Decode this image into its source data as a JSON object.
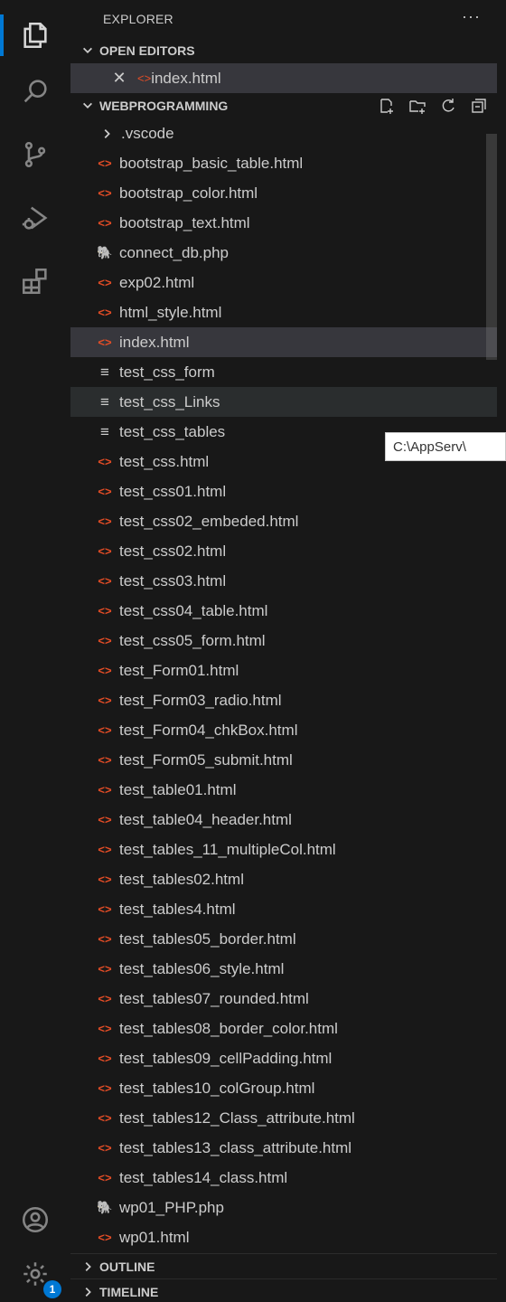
{
  "activity": [
    {
      "name": "explorer-icon",
      "active": true
    },
    {
      "name": "search-icon",
      "active": false
    },
    {
      "name": "source-control-icon",
      "active": false
    },
    {
      "name": "run-debug-icon",
      "active": false
    },
    {
      "name": "extensions-icon",
      "active": false
    }
  ],
  "activity_bottom": {
    "account": "account-icon",
    "settings": "gear-icon",
    "settings_badge": "1"
  },
  "explorer": {
    "title": "EXPLORER",
    "more": "···"
  },
  "open_editors": {
    "label": "OPEN EDITORS",
    "items": [
      {
        "name": "index.html",
        "icon": "html"
      }
    ]
  },
  "workspace": {
    "label": "WEBPROGRAMMING",
    "actions": [
      "new-file-icon",
      "new-folder-icon",
      "refresh-icon",
      "collapse-all-icon"
    ],
    "items": [
      {
        "name": ".vscode",
        "icon": "folder"
      },
      {
        "name": "bootstrap_basic_table.html",
        "icon": "html"
      },
      {
        "name": "bootstrap_color.html",
        "icon": "html"
      },
      {
        "name": "bootstrap_text.html",
        "icon": "html"
      },
      {
        "name": "connect_db.php",
        "icon": "php"
      },
      {
        "name": "exp02.html",
        "icon": "html"
      },
      {
        "name": "html_style.html",
        "icon": "html"
      },
      {
        "name": "index.html",
        "icon": "html",
        "state": "selected"
      },
      {
        "name": "test_css_form",
        "icon": "txt"
      },
      {
        "name": "test_css_Links",
        "icon": "txt",
        "state": "hover"
      },
      {
        "name": "test_css_tables",
        "icon": "txt"
      },
      {
        "name": "test_css.html",
        "icon": "html"
      },
      {
        "name": "test_css01.html",
        "icon": "html"
      },
      {
        "name": "test_css02_embeded.html",
        "icon": "html"
      },
      {
        "name": "test_css02.html",
        "icon": "html"
      },
      {
        "name": "test_css03.html",
        "icon": "html"
      },
      {
        "name": "test_css04_table.html",
        "icon": "html"
      },
      {
        "name": "test_css05_form.html",
        "icon": "html"
      },
      {
        "name": "test_Form01.html",
        "icon": "html"
      },
      {
        "name": "test_Form03_radio.html",
        "icon": "html"
      },
      {
        "name": "test_Form04_chkBox.html",
        "icon": "html"
      },
      {
        "name": "test_Form05_submit.html",
        "icon": "html"
      },
      {
        "name": "test_table01.html",
        "icon": "html"
      },
      {
        "name": "test_table04_header.html",
        "icon": "html"
      },
      {
        "name": "test_tables_11_multipleCol.html",
        "icon": "html"
      },
      {
        "name": "test_tables02.html",
        "icon": "html"
      },
      {
        "name": "test_tables4.html",
        "icon": "html"
      },
      {
        "name": "test_tables05_border.html",
        "icon": "html"
      },
      {
        "name": "test_tables06_style.html",
        "icon": "html"
      },
      {
        "name": "test_tables07_rounded.html",
        "icon": "html"
      },
      {
        "name": "test_tables08_border_color.html",
        "icon": "html"
      },
      {
        "name": "test_tables09_cellPadding.html",
        "icon": "html"
      },
      {
        "name": "test_tables10_colGroup.html",
        "icon": "html"
      },
      {
        "name": "test_tables12_Class_attribute.html",
        "icon": "html"
      },
      {
        "name": "test_tables13_class_attribute.html",
        "icon": "html"
      },
      {
        "name": "test_tables14_class.html",
        "icon": "html"
      },
      {
        "name": "wp01_PHP.php",
        "icon": "php"
      },
      {
        "name": "wp01.html",
        "icon": "html"
      }
    ]
  },
  "tooltip": "C:\\AppServ\\",
  "outline": {
    "label": "OUTLINE"
  },
  "timeline": {
    "label": "TIMELINE"
  },
  "colors": {
    "background": "#181818",
    "accent": "#0078d4",
    "html_icon": "#e44d26",
    "php_icon": "#a074c4",
    "selected_row": "#37373d"
  }
}
